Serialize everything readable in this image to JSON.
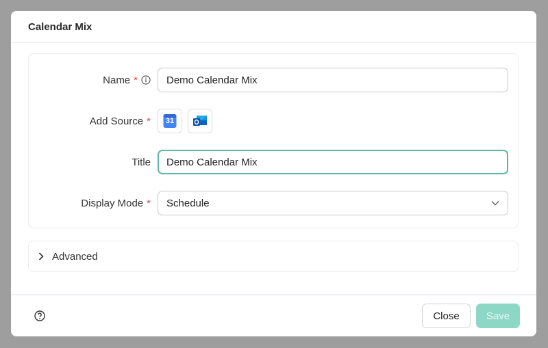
{
  "dialog": {
    "title": "Calendar Mix"
  },
  "form": {
    "name": {
      "label": "Name",
      "required": "*",
      "value": "Demo Calendar Mix"
    },
    "source": {
      "label": "Add Source",
      "required": "*",
      "google_day": "31"
    },
    "title": {
      "label": "Title",
      "value": "Demo Calendar Mix"
    },
    "display_mode": {
      "label": "Display Mode",
      "required": "*",
      "value": "Schedule"
    }
  },
  "advanced": {
    "label": "Advanced"
  },
  "footer": {
    "close_label": "Close",
    "save_label": "Save"
  },
  "colors": {
    "accent": "#5db8a4",
    "save_disabled": "#8dd7c6",
    "required": "#e5484d"
  },
  "icons": [
    "info-icon",
    "google-calendar-icon",
    "outlook-icon",
    "chevron-down-icon",
    "chevron-right-icon",
    "help-icon"
  ]
}
